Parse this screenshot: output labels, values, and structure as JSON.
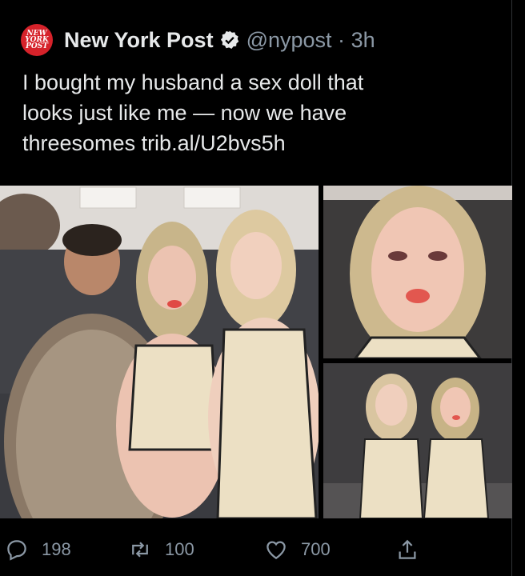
{
  "tweet": {
    "account_name": "New York Post",
    "handle": "@nypost",
    "separator": "·",
    "time": "3h",
    "logo_text": [
      "NEW",
      "YORK",
      "POST"
    ],
    "text": "I bought my husband a sex doll that\nlooks just like me — now we have\nthreesomes trib.al/U2bvs5h"
  },
  "actions": {
    "replies": "198",
    "retweets": "100",
    "likes": "700"
  },
  "colors": {
    "background": "#000000",
    "text": "#e7e9ea",
    "muted": "#8b98a5",
    "logo_red": "#d6222a"
  }
}
